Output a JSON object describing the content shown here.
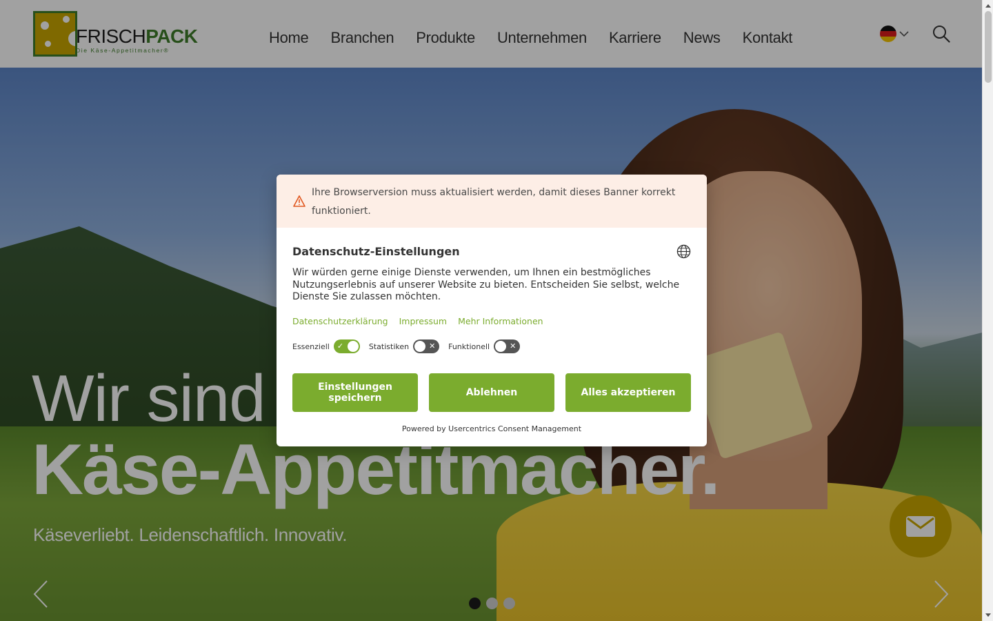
{
  "header": {
    "logo_word_1": "FRISCH",
    "logo_word_2": "PACK",
    "logo_tagline": "Die Käse-Appetitmacher®",
    "nav": [
      "Home",
      "Branchen",
      "Produkte",
      "Unternehmen",
      "Karriere",
      "News",
      "Kontakt"
    ],
    "language_flag": "german-flag-icon",
    "search_icon": "search-icon"
  },
  "hero": {
    "line1": "Wir sind",
    "line2": "Käse-Appetitmacher.",
    "subtitle": "Käseverliebt. Leidenschaftlich. Innovativ.",
    "slides_total": 3,
    "slide_active": 1,
    "mail_icon": "mail-icon"
  },
  "consent": {
    "warning_text": "Ihre Browserversion muss aktualisiert werden, damit dieses Banner korrekt funktioniert.",
    "title": "Datenschutz-Einstellungen",
    "description": "Wir würden gerne einige Dienste verwenden, um Ihnen ein bestmögliches Nutzungserlebnis auf unserer Website zu bieten. Entscheiden Sie selbst, welche Dienste Sie zulassen möchten.",
    "links": [
      "Datenschutzerklärung",
      "Impressum",
      "Mehr Informationen"
    ],
    "toggles": [
      {
        "label": "Essenziell",
        "state": "on"
      },
      {
        "label": "Statistiken",
        "state": "off"
      },
      {
        "label": "Funktionell",
        "state": "off"
      }
    ],
    "buttons": {
      "save": "Einstellungen speichern",
      "deny": "Ablehnen",
      "accept_all": "Alles akzeptieren"
    },
    "powered_by": "Powered by Usercentrics Consent Management"
  },
  "colors": {
    "brand_green": "#3f7d2a",
    "brand_yellow": "#c9a700",
    "consent_green": "#7bac2e",
    "warning_bg": "#fdeee6"
  }
}
